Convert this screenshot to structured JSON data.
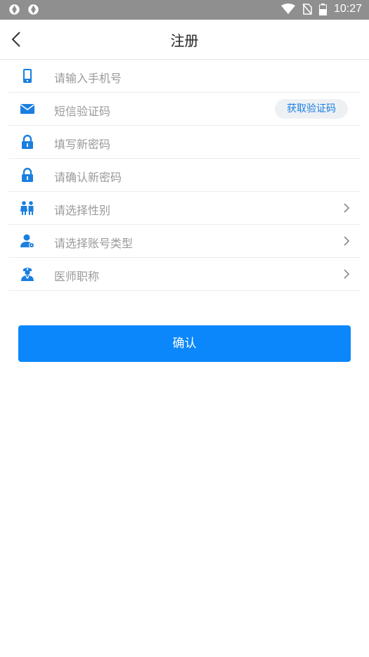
{
  "status": {
    "time": "10:27"
  },
  "header": {
    "title": "注册"
  },
  "form": {
    "phone_placeholder": "请输入手机号",
    "sms_placeholder": "短信验证码",
    "get_code_label": "获取验证码",
    "new_password_placeholder": "填写新密码",
    "confirm_password_placeholder": "请确认新密码",
    "gender_placeholder": "请选择性别",
    "account_type_placeholder": "请选择账号类型",
    "doctor_title_placeholder": "医师职称"
  },
  "actions": {
    "confirm_label": "确认"
  },
  "colors": {
    "accent": "#0b87fb",
    "icon": "#1a7fe0",
    "statusbar": "#8f8f8f"
  }
}
